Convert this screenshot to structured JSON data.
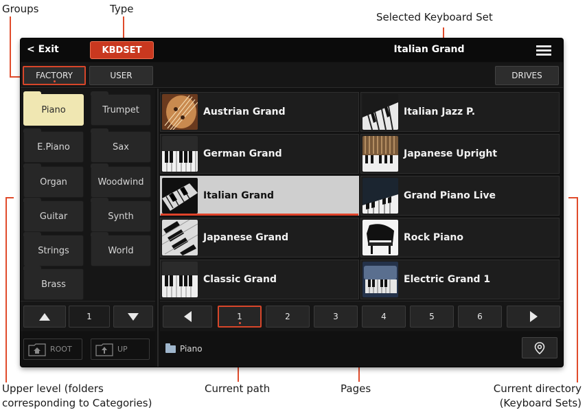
{
  "callouts": {
    "groups": "Groups",
    "type": "Type",
    "selected_set": "Selected Keyboard Set",
    "upper_level_1": "Upper level (folders",
    "upper_level_2": "corresponding to Categories)",
    "current_path": "Current path",
    "pages": "Pages",
    "current_dir_1": "Current directory",
    "current_dir_2": "(Keyboard Sets)"
  },
  "header": {
    "exit_label": "< Exit",
    "type_label": "KBDSET",
    "selected_set": "Italian Grand",
    "menu_icon": "menu-icon"
  },
  "tabs": {
    "factory": "FACTORY",
    "user": "USER",
    "drives": "DRIVES",
    "active": "FACTORY"
  },
  "categories": [
    {
      "label": "Piano",
      "selected": true
    },
    {
      "label": "Trumpet"
    },
    {
      "label": "E.Piano"
    },
    {
      "label": "Sax"
    },
    {
      "label": "Organ"
    },
    {
      "label": "Woodwind"
    },
    {
      "label": "Guitar"
    },
    {
      "label": "Synth"
    },
    {
      "label": "Strings"
    },
    {
      "label": "World"
    },
    {
      "label": "Brass"
    }
  ],
  "sets": [
    {
      "label": "Austrian Grand",
      "icon": "piano-strings-icon"
    },
    {
      "label": "Italian Jazz P.",
      "icon": "piano-keys-icon"
    },
    {
      "label": "German Grand",
      "icon": "piano-keys-icon"
    },
    {
      "label": "Japanese Upright",
      "icon": "upright-piano-icon"
    },
    {
      "label": "Italian Grand",
      "icon": "piano-keys-icon",
      "selected": true
    },
    {
      "label": "Grand Piano Live",
      "icon": "piano-keys-icon"
    },
    {
      "label": "Japanese Grand",
      "icon": "piano-keys-icon"
    },
    {
      "label": "Rock Piano",
      "icon": "grand-piano-icon"
    },
    {
      "label": "Classic Grand",
      "icon": "piano-keys-icon"
    },
    {
      "label": "Electric Grand 1",
      "icon": "electric-piano-icon"
    }
  ],
  "left_pager": {
    "value": "1"
  },
  "pages": [
    "1",
    "2",
    "3",
    "4",
    "5",
    "6"
  ],
  "current_page": "1",
  "nav": {
    "root": "ROOT",
    "up": "UP"
  },
  "path": {
    "text": "Piano"
  },
  "colors": {
    "accent": "#d8462a",
    "selected_category": "#f0e7b2",
    "selected_item": "#cfcfcf"
  }
}
